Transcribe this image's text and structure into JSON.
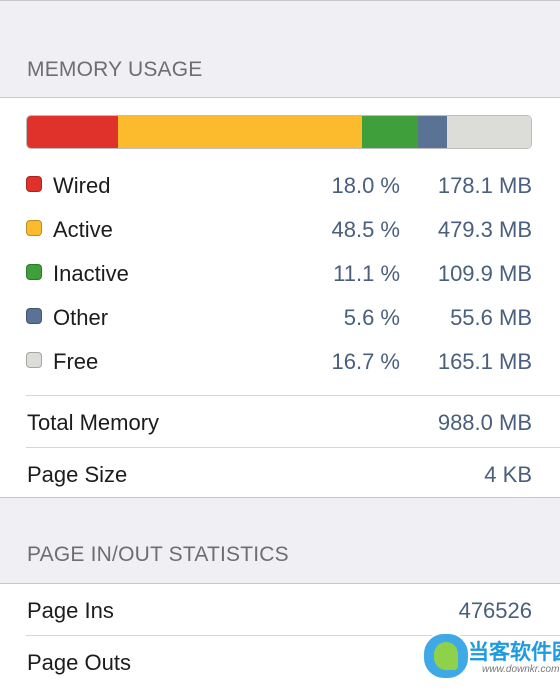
{
  "memory_section": {
    "header": "MEMORY USAGE",
    "bar_segments": [
      {
        "name": "Wired",
        "percent": 18.0,
        "color": "#e0312b"
      },
      {
        "name": "Active",
        "percent": 48.5,
        "color": "#fbbb2c"
      },
      {
        "name": "Inactive",
        "percent": 11.1,
        "color": "#3f9f3a"
      },
      {
        "name": "Other",
        "percent": 5.6,
        "color": "#5a7294"
      },
      {
        "name": "Free",
        "percent": 16.7,
        "color": "#dcdcd8"
      }
    ],
    "legend": [
      {
        "label": "Wired",
        "percent": "18.0 %",
        "value": "178.1 MB",
        "color": "#e0312b"
      },
      {
        "label": "Active",
        "percent": "48.5 %",
        "value": "479.3 MB",
        "color": "#fbbb2c"
      },
      {
        "label": "Inactive",
        "percent": "11.1 %",
        "value": "109.9 MB",
        "color": "#3f9f3a"
      },
      {
        "label": "Other",
        "percent": "5.6 %",
        "value": "55.6 MB",
        "color": "#5a7294"
      },
      {
        "label": "Free",
        "percent": "16.7 %",
        "value": "165.1 MB",
        "color": "#dcdcd8"
      }
    ],
    "total_memory": {
      "label": "Total Memory",
      "value": "988.0 MB"
    },
    "page_size": {
      "label": "Page Size",
      "value": "4 KB"
    }
  },
  "page_section": {
    "header": "PAGE IN/OUT STATISTICS",
    "page_ins": {
      "label": "Page Ins",
      "value": "476526"
    },
    "page_outs": {
      "label": "Page Outs",
      "value": ""
    }
  },
  "watermark": {
    "text": "当客软件园",
    "url": "www.downkr.com"
  }
}
